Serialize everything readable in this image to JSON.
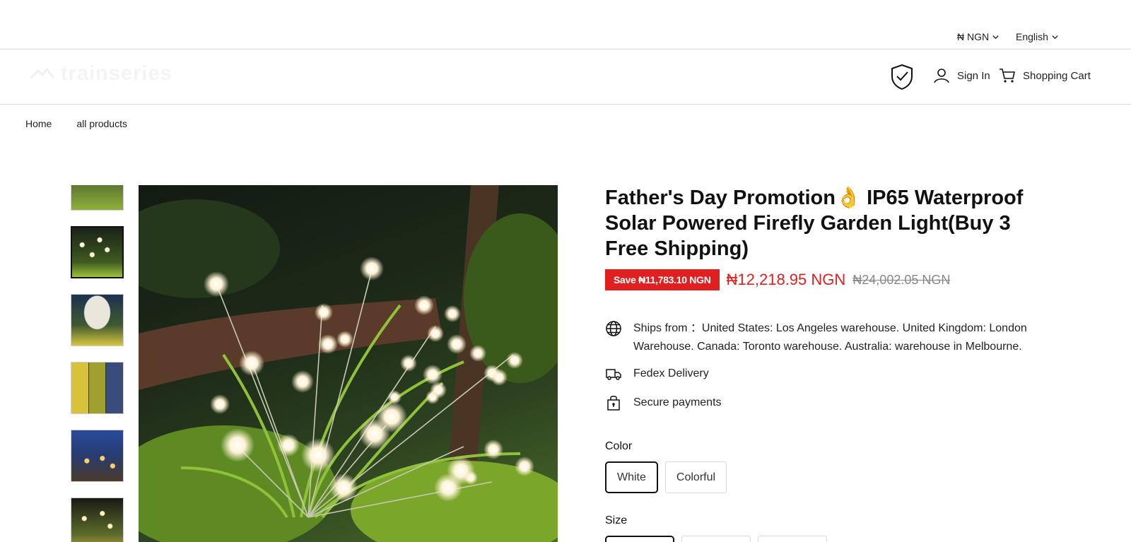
{
  "topbar": {
    "currency": "₦ NGN",
    "language": "English"
  },
  "header": {
    "logo_text": "trainseries",
    "signin_label": "Sign In",
    "cart_label": "Shopping Cart"
  },
  "breadcrumb": {
    "items": [
      "Home",
      "all products"
    ]
  },
  "gallery": {
    "thumbnail_count": 6,
    "active_index": 1
  },
  "product": {
    "title": "Father's Day Promotion👌 IP65 Waterproof Solar Powered Firefly Garden Light(Buy 3 Free Shipping)",
    "save_badge": "Save ₦11,783.10 NGN",
    "price": "₦12,218.95 NGN",
    "compare_price": "₦24,002.05 NGN",
    "features": {
      "ships_from": "Ships from ：United States: Los Angeles warehouse. United Kingdom: London Warehouse. Canada: Toronto warehouse. Australia: warehouse in Melbourne.",
      "delivery": "Fedex Delivery",
      "payments": "Secure payments"
    },
    "color_label": "Color",
    "colors": [
      "White",
      "Colorful"
    ],
    "selected_color": "White",
    "size_label": "Size"
  },
  "colors": {
    "sale_red": "#e02020",
    "text": "#1a1a1a",
    "border": "#d9d9d9"
  }
}
